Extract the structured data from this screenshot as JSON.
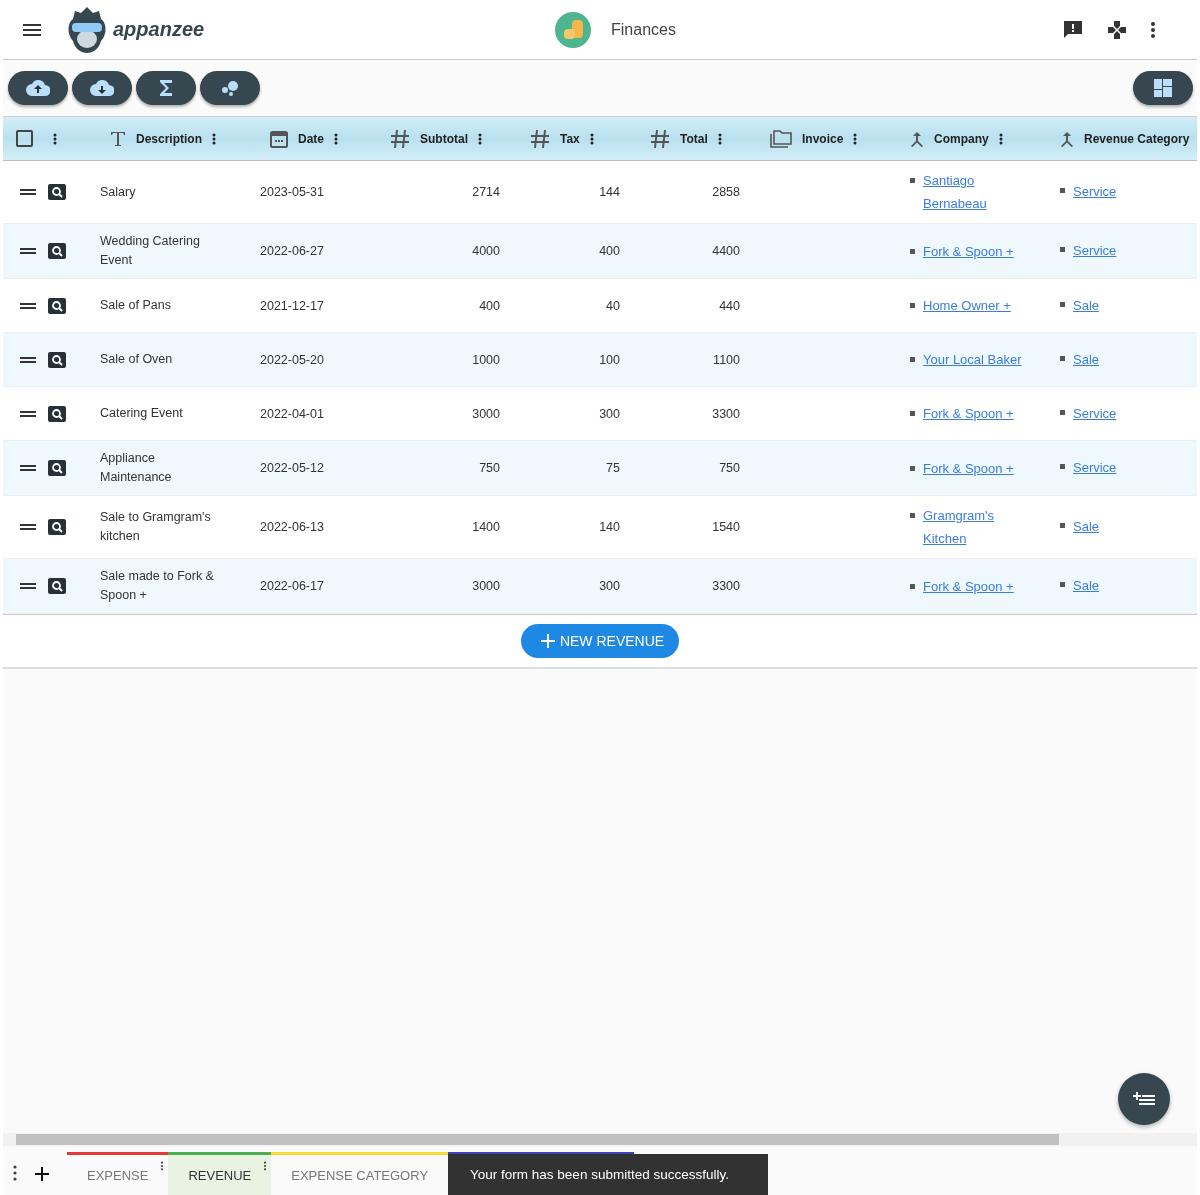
{
  "app_bar": {
    "logo_text": "appanzee",
    "title": "Finances"
  },
  "table": {
    "columns": [
      {
        "label": "Description",
        "kind": "text"
      },
      {
        "label": "Date",
        "kind": "date"
      },
      {
        "label": "Subtotal",
        "kind": "number"
      },
      {
        "label": "Tax",
        "kind": "number"
      },
      {
        "label": "Total",
        "kind": "number"
      },
      {
        "label": "Invoice",
        "kind": "file"
      },
      {
        "label": "Company",
        "kind": "relation"
      },
      {
        "label": "Revenue Category",
        "kind": "relation"
      }
    ],
    "select_all": {
      "checked": false
    },
    "rows": [
      {
        "description": "Salary",
        "date": "2023-05-31",
        "subtotal": "2714",
        "tax": "144",
        "total": "2858",
        "company": "Santiago Bernabeau",
        "category": "Service"
      },
      {
        "description": "Wedding Catering Event",
        "date": "2022-06-27",
        "subtotal": "4000",
        "tax": "400",
        "total": "4400",
        "company": "Fork & Spoon +",
        "category": "Service"
      },
      {
        "description": "Sale of Pans",
        "date": "2021-12-17",
        "subtotal": "400",
        "tax": "40",
        "total": "440",
        "company": "Home Owner +",
        "category": "Sale"
      },
      {
        "description": "Sale of Oven",
        "date": "2022-05-20",
        "subtotal": "1000",
        "tax": "100",
        "total": "1100",
        "company": "Your Local Baker",
        "category": "Sale"
      },
      {
        "description": "Catering Event",
        "date": "2022-04-01",
        "subtotal": "3000",
        "tax": "300",
        "total": "3300",
        "company": "Fork & Spoon +",
        "category": "Service"
      },
      {
        "description": "Appliance Maintenance",
        "date": "2022-05-12",
        "subtotal": "750",
        "tax": "75",
        "total": "750",
        "company": "Fork & Spoon +",
        "category": "Service"
      },
      {
        "description": "Sale to Gramgram's kitchen",
        "date": "2022-06-13",
        "subtotal": "1400",
        "tax": "140",
        "total": "1540",
        "company": "Gramgram's Kitchen",
        "category": "Sale"
      },
      {
        "description": "Sale made to Fork & Spoon +",
        "date": "2022-06-17",
        "subtotal": "3000",
        "tax": "300",
        "total": "3300",
        "company": "Fork & Spoon +",
        "category": "Sale"
      }
    ],
    "new_button": "NEW REVENUE"
  },
  "sheet_tabs": [
    {
      "label": "EXPENSE",
      "color": "#e53935",
      "selected": false,
      "menu": true
    },
    {
      "label": "REVENUE",
      "color": "#4caf50",
      "selected": true,
      "menu": true
    },
    {
      "label": "EXPENSE CATEGORY",
      "color": "#fdd835",
      "selected": false,
      "menu": false
    },
    {
      "color": "#3f3fbf"
    }
  ],
  "snackbar": "Your form has been submitted successfully."
}
